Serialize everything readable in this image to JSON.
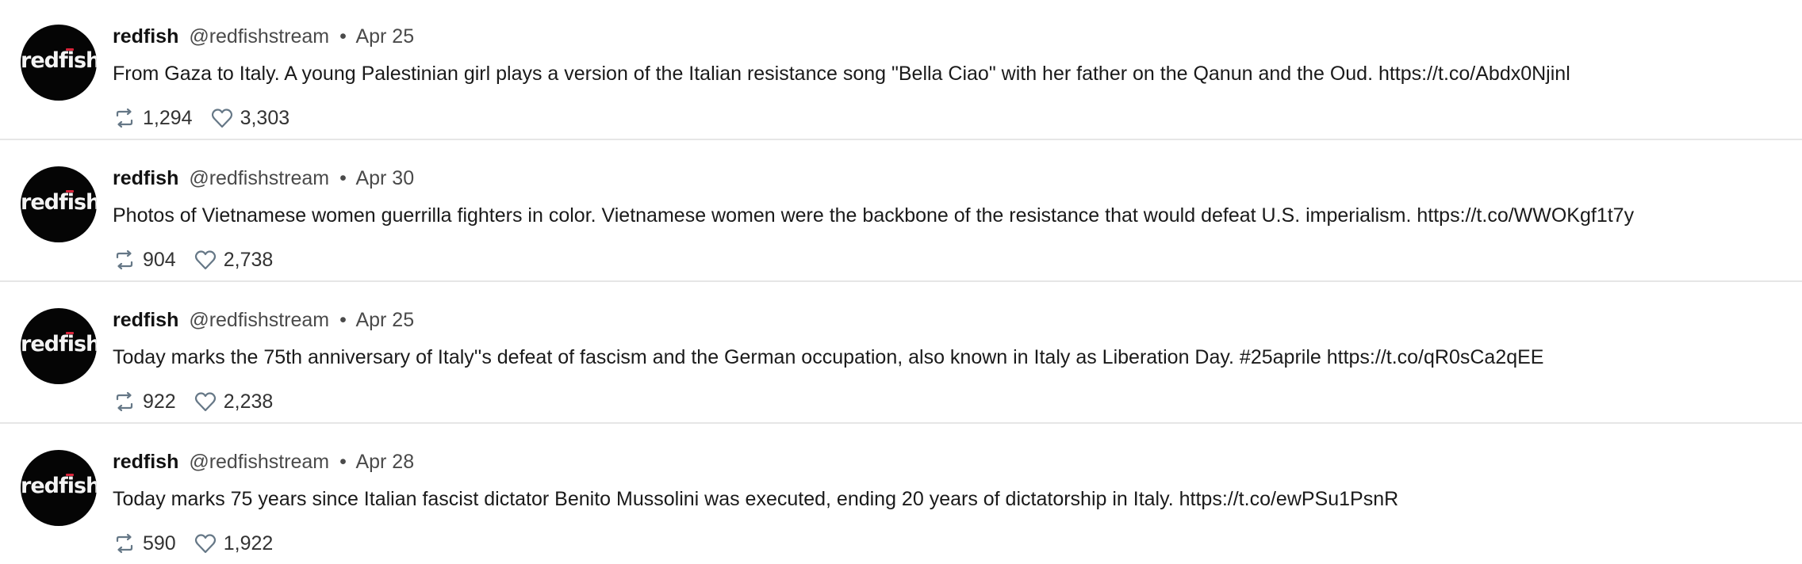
{
  "tweets": [
    {
      "name": "redfish",
      "handle": "@redfishstream",
      "separator": "•",
      "date": "Apr 25",
      "avatar_text": "redfish",
      "text": "From Gaza to Italy. A young Palestinian girl plays a version of the Italian resistance song \"Bella Ciao\" with her father on the Qanun and the Oud. https://t.co/Abdx0Njinl",
      "retweets": "1,294",
      "likes": "3,303"
    },
    {
      "name": "redfish",
      "handle": "@redfishstream",
      "separator": "•",
      "date": "Apr 30",
      "avatar_text": "redfish",
      "text": "Photos of Vietnamese women guerrilla fighters in color. Vietnamese women were the backbone of the resistance that would defeat U.S. imperialism. https://t.co/WWOKgf1t7y",
      "retweets": "904",
      "likes": "2,738"
    },
    {
      "name": "redfish",
      "handle": "@redfishstream",
      "separator": "•",
      "date": "Apr 25",
      "avatar_text": "redfish",
      "text": "Today marks the 75th anniversary of Italy''s defeat of fascism and the German occupation, also known in Italy as Liberation Day. #25aprile https://t.co/qR0sCa2qEE",
      "retweets": "922",
      "likes": "2,238"
    },
    {
      "name": "redfish",
      "handle": "@redfishstream",
      "separator": "•",
      "date": "Apr 28",
      "avatar_text": "redfish",
      "text": "Today marks 75 years since Italian fascist dictator Benito Mussolini was executed, ending 20 years of dictatorship in Italy. https://t.co/ewPSu1PsnR",
      "retweets": "590",
      "likes": "1,922"
    }
  ],
  "icons": {
    "retweet": "retweet-icon",
    "like": "heart-icon"
  },
  "colors": {
    "avatar_bg": "#050505",
    "avatar_accent": "#d8243a",
    "divider": "#e6e6e6",
    "icon": "#657786"
  }
}
